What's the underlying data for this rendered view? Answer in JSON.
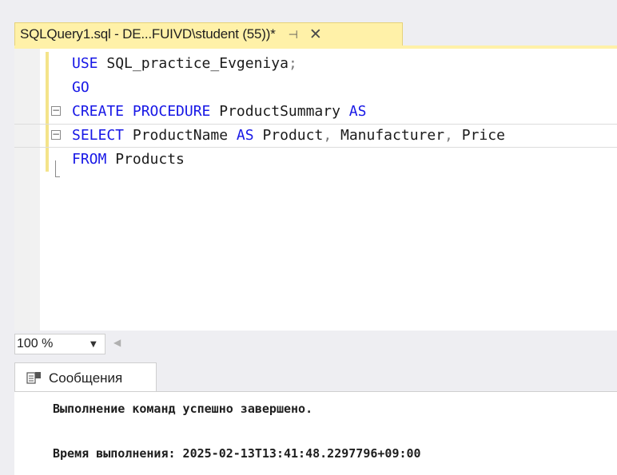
{
  "document_tab": {
    "title": "SQLQuery1.sql - DE...FUIVD\\student (55))*",
    "pin_glyph": "⊣",
    "close_glyph": "✕"
  },
  "editor": {
    "lines": [
      {
        "fold": false,
        "tokens": [
          {
            "t": "USE",
            "c": "kw"
          },
          {
            "t": " SQL_practice_Evgeniya",
            "c": "pl"
          },
          {
            "t": ";",
            "c": "gray"
          }
        ]
      },
      {
        "fold": false,
        "tokens": [
          {
            "t": "GO",
            "c": "kw"
          }
        ]
      },
      {
        "fold": true,
        "tokens": [
          {
            "t": "CREATE PROCEDURE",
            "c": "kw"
          },
          {
            "t": " ProductSummary ",
            "c": "pl"
          },
          {
            "t": "AS",
            "c": "kw"
          }
        ]
      },
      {
        "fold": true,
        "tokens": [
          {
            "t": "SELECT",
            "c": "kw"
          },
          {
            "t": " ProductName ",
            "c": "pl"
          },
          {
            "t": "AS",
            "c": "kw"
          },
          {
            "t": " Product",
            "c": "pl"
          },
          {
            "t": ",",
            "c": "gray"
          },
          {
            "t": " Manufacturer",
            "c": "pl"
          },
          {
            "t": ",",
            "c": "gray"
          },
          {
            "t": " Price",
            "c": "pl"
          }
        ]
      },
      {
        "fold": false,
        "tokens": [
          {
            "t": "FROM",
            "c": "kw"
          },
          {
            "t": " Products",
            "c": "pl"
          }
        ]
      }
    ]
  },
  "zoom": {
    "value": "100 %"
  },
  "messages": {
    "tab_label": "Сообщения",
    "lines": [
      "Выполнение команд успешно завершено.",
      "Время выполнения: 2025-02-13T13:41:48.2297796+09:00"
    ]
  },
  "colors": {
    "keyword": "#1717e6",
    "tab_active": "#fff1a8",
    "change_bar": "#f4e48a"
  }
}
